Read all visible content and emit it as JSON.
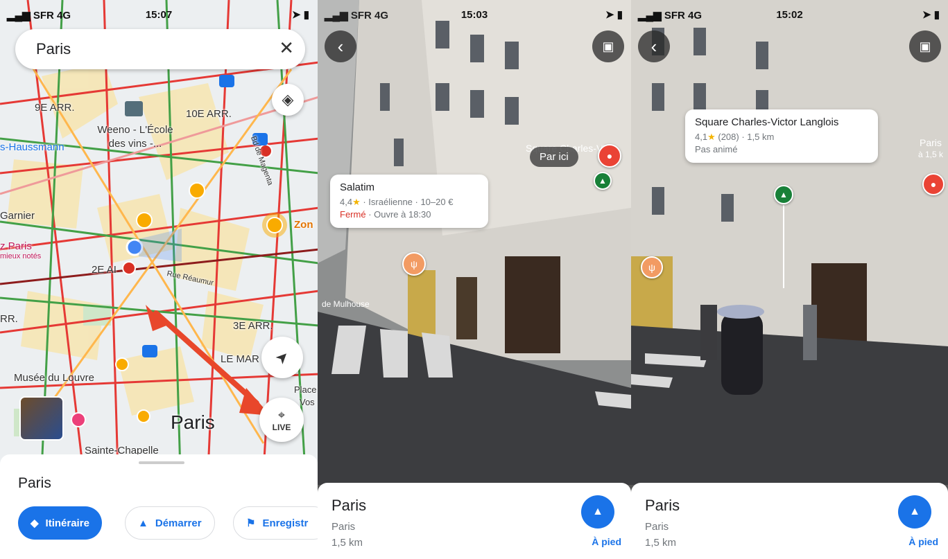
{
  "colors": {
    "accent": "#1a73e8",
    "closed": "#d93025",
    "star": "#f4b400",
    "pin_red": "#ea4335",
    "pin_green": "#188038",
    "pin_food": "#f29b63"
  },
  "panel1": {
    "status": {
      "carrier": "SFR",
      "network": "4G",
      "time": "15:07"
    },
    "search": {
      "query": "Paris"
    },
    "map_labels": {
      "arr9": "9E ARR.",
      "arr10": "10E ARR.",
      "arr2": "2E AI",
      "arr3": "3E ARR.",
      "weeno": "Weeno - L'École des vins -...",
      "haussmann": "s-Haussmann",
      "garnier": "Garnier",
      "zparis": "z Paris",
      "mieux": "mieux notés",
      "reaumur": "Rue Réaumur",
      "bdmagenta": "Bd de Magenta",
      "lemar": "LE MAR",
      "louvre": "Musée du Louvre",
      "paris": "Paris",
      "sainte": "Sainte-Chapelle",
      "zone": "Zon",
      "rr": "RR.",
      "place": "Place",
      "vos": "Vos",
      "rue": "Rue",
      "hyp": "Hyp"
    },
    "live_label": "LIVE",
    "sheet": {
      "title": "Paris",
      "directions": "Itinéraire",
      "start": "Démarrer",
      "save": "Enregistr"
    }
  },
  "panel2": {
    "status": {
      "carrier": "SFR",
      "network": "4G",
      "time": "15:03"
    },
    "bubble": {
      "name": "Salatim",
      "rating": "4,4",
      "meta": "· Israélienne · 10–20 €",
      "closed": "Fermé",
      "opens": "· Ouvre à 18:30"
    },
    "pill": "Par ici",
    "sign": "Square Charles-Vic",
    "street": "de Mulhouse",
    "card": {
      "title": "Paris",
      "sub1": "Paris",
      "sub2": "1,5 km",
      "walk": "À pied"
    }
  },
  "panel3": {
    "status": {
      "carrier": "SFR",
      "network": "4G",
      "time": "15:02"
    },
    "bubble": {
      "name": "Square Charles-Victor Langlois",
      "rating": "4,1",
      "meta": "(208) · 1,5 km",
      "status": "Pas animé"
    },
    "edge": "Paris",
    "edge2": "à 1,5 k",
    "card": {
      "title": "Paris",
      "sub1": "Paris",
      "sub2": "1,5 km",
      "walk": "À pied"
    }
  }
}
